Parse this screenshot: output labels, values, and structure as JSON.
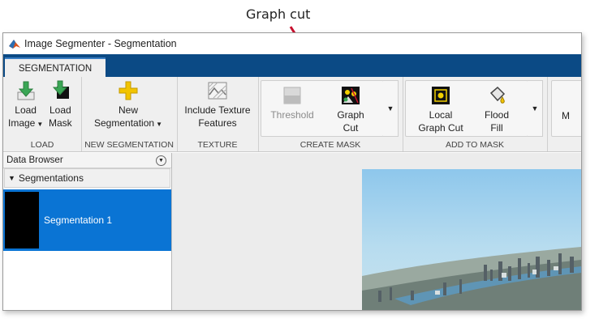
{
  "annotation": {
    "label": "Graph cut"
  },
  "window": {
    "title": "Image Segmenter - Segmentation"
  },
  "tabs": [
    {
      "label": "SEGMENTATION"
    }
  ],
  "ribbon": {
    "load": {
      "label": "LOAD",
      "load_image": [
        "Load",
        "Image"
      ],
      "load_mask": [
        "Load",
        "Mask"
      ]
    },
    "new_segmentation": {
      "label": "NEW SEGMENTATION",
      "new_segmentation": [
        "New",
        "Segmentation"
      ]
    },
    "texture": {
      "label": "TEXTURE",
      "include_texture": [
        "Include Texture",
        "Features"
      ]
    },
    "create_mask": {
      "label": "CREATE MASK",
      "threshold": "Threshold",
      "graph_cut": [
        "Graph",
        "Cut"
      ]
    },
    "add_to_mask": {
      "label": "ADD TO MASK",
      "local_graph_cut": [
        "Local",
        "Graph Cut"
      ],
      "flood_fill": [
        "Flood",
        "Fill"
      ]
    },
    "truncated_label": "M"
  },
  "data_browser": {
    "title": "Data Browser",
    "section": "Segmentations",
    "items": [
      {
        "label": "Segmentation 1"
      }
    ]
  },
  "colors": {
    "tabstrip": "#0b4a85",
    "selection": "#0a74d4",
    "annotation_arrow": "#c8102e"
  }
}
